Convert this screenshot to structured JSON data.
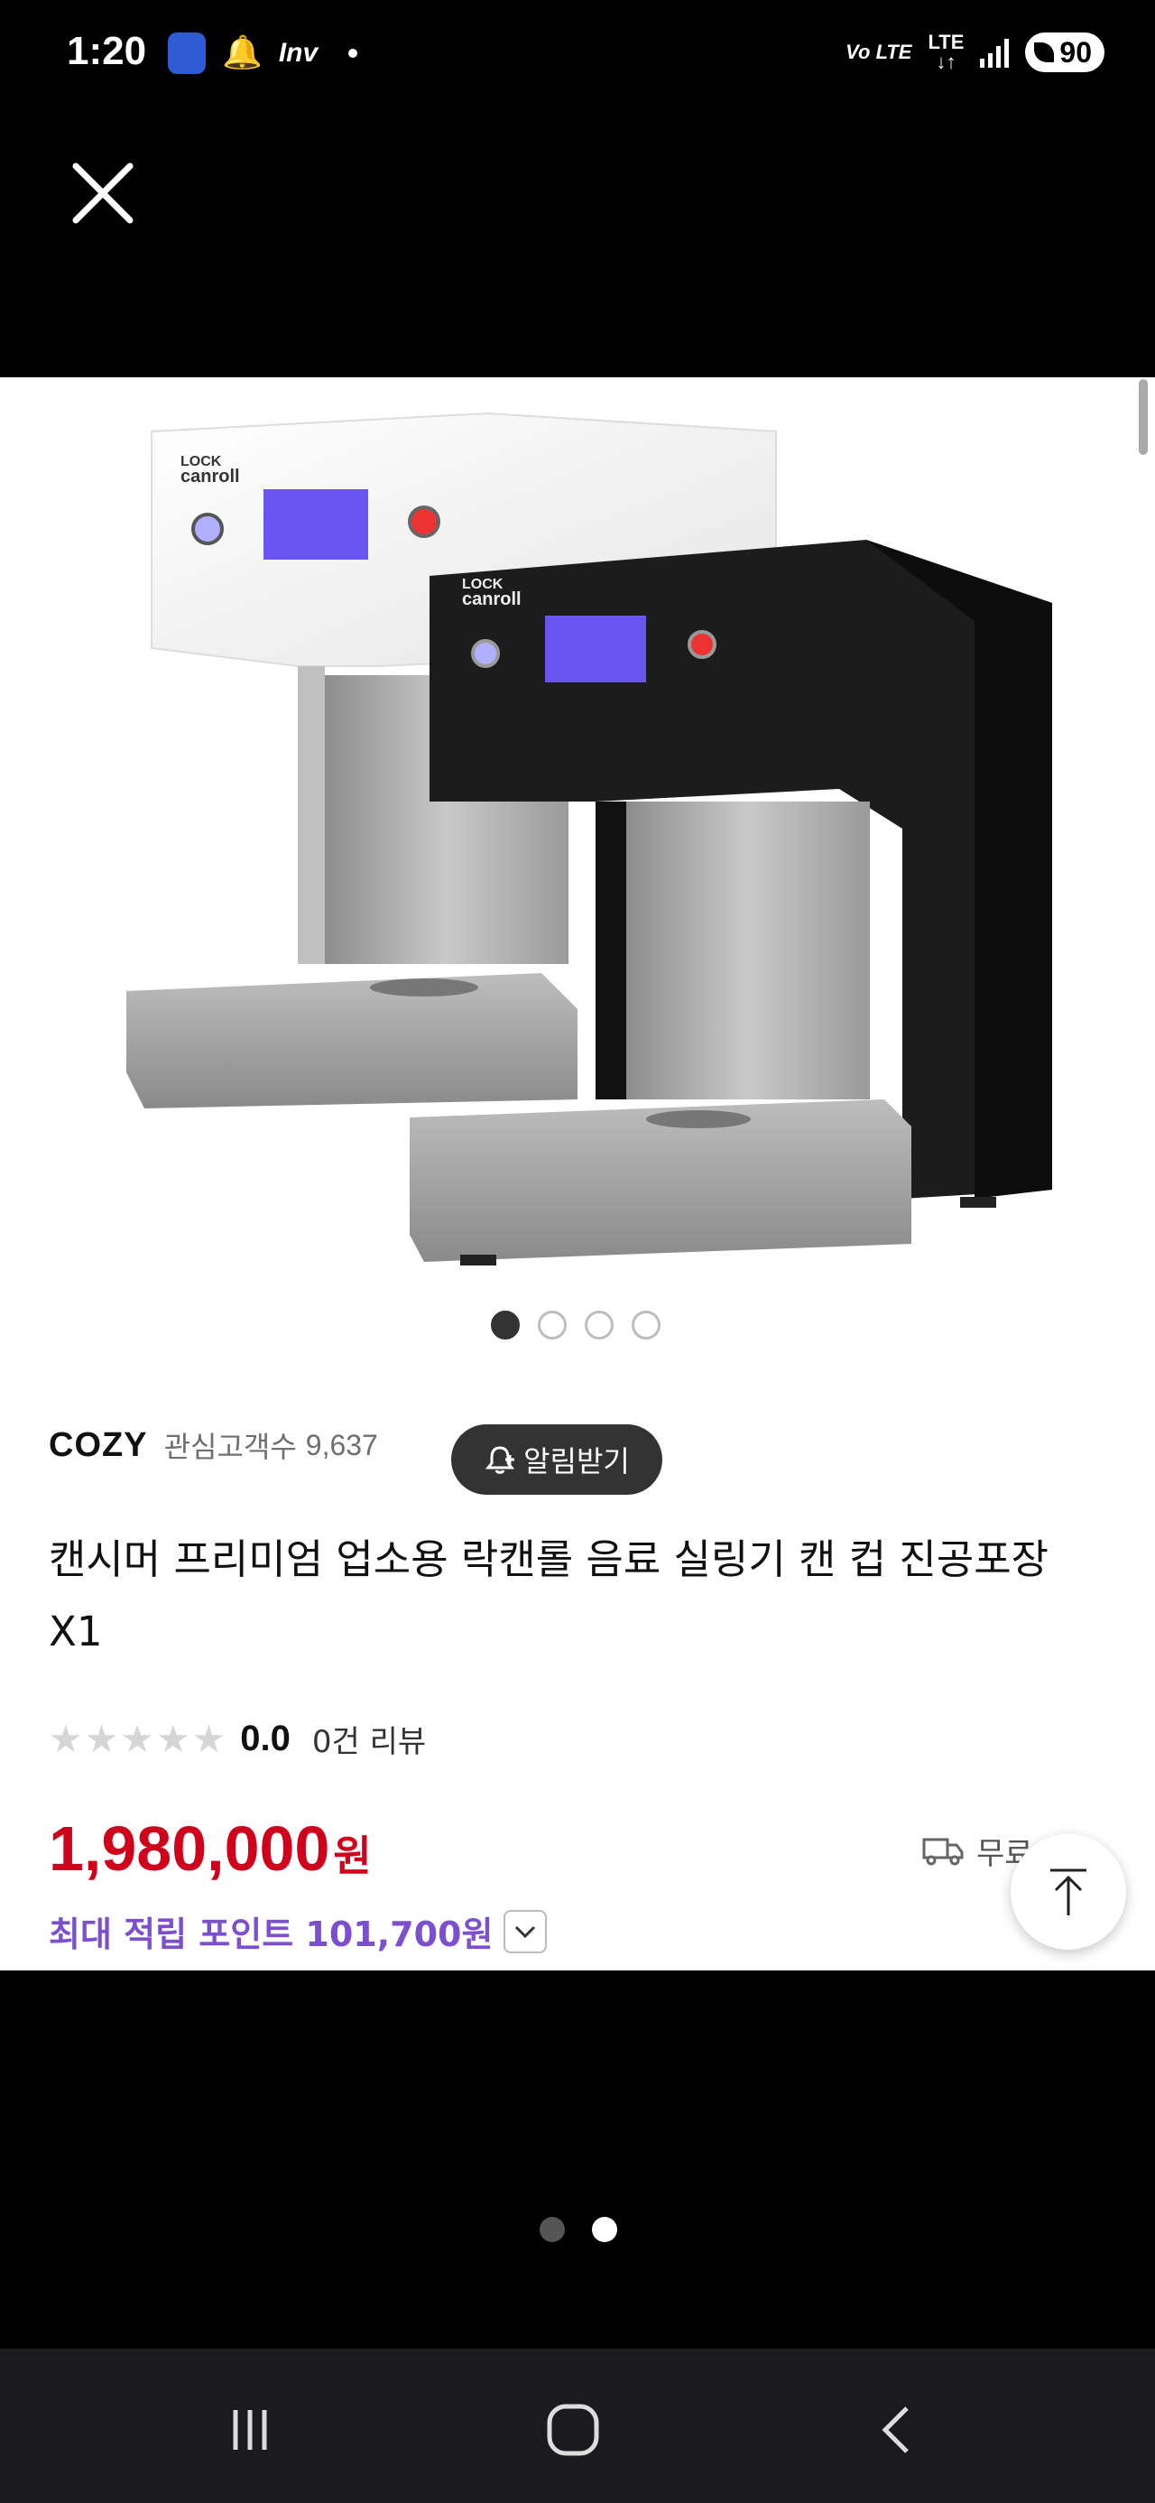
{
  "status_bar": {
    "time": "1:20",
    "carrier_label": "Inv",
    "volte_label": "Vo LTE",
    "network_label": "LTE",
    "battery_level": "90"
  },
  "top_bar": {
    "close_icon": "close-icon"
  },
  "carousel": {
    "image_count": 4,
    "active_index": 0
  },
  "product": {
    "seller": "COZY",
    "follower_label": "관심고객수",
    "follower_count": "9,637",
    "alert_button_label": "알림받기",
    "title": "캔시머 프리미엄 업소용 락캔롤 음료 실링기 캔 컵 진공포장 X1",
    "rating_score": "0.0",
    "review_count": "0건 리뷰",
    "stars_filled": 0,
    "stars_total": 5,
    "price_value": "1,980,000",
    "price_unit": "원",
    "shipping_label": "무료",
    "points_text": "최대 적립 포인트 101,700원"
  },
  "colors": {
    "price": "#d0021b",
    "points": "#7b4fd0",
    "alert_button_bg": "#333333"
  },
  "page_indicator": {
    "count": 2,
    "active_index": 1
  }
}
